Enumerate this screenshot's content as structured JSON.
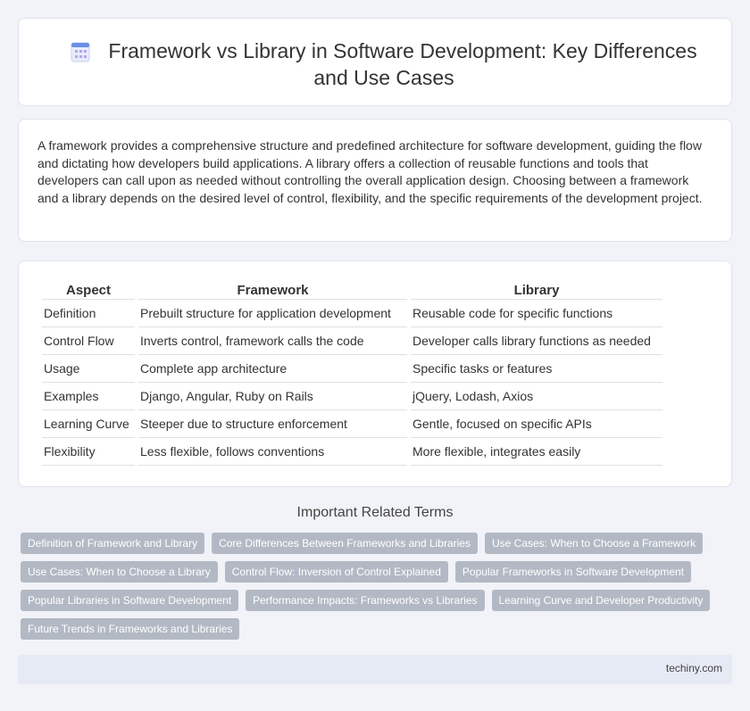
{
  "header": {
    "title": "Framework vs Library in Software Development: Key Differences and Use Cases",
    "icon": "document-icon"
  },
  "summary": {
    "text": "A framework provides a comprehensive structure and predefined architecture for software development, guiding the flow and dictating how developers build applications. A library offers a collection of reusable functions and tools that developers can call upon as needed without controlling the overall application design. Choosing between a framework and a library depends on the desired level of control, flexibility, and the specific requirements of the development project."
  },
  "table": {
    "headers": [
      "Aspect",
      "Framework",
      "Library"
    ],
    "rows": [
      [
        "Definition",
        "Prebuilt structure for application development",
        "Reusable code for specific functions"
      ],
      [
        "Control Flow",
        "Inverts control, framework calls the code",
        "Developer calls library functions as needed"
      ],
      [
        "Usage",
        "Complete app architecture",
        "Specific tasks or features"
      ],
      [
        "Examples",
        "Django, Angular, Ruby on Rails",
        "jQuery, Lodash, Axios"
      ],
      [
        "Learning Curve",
        "Steeper due to structure enforcement",
        "Gentle, focused on specific APIs"
      ],
      [
        "Flexibility",
        "Less flexible, follows conventions",
        "More flexible, integrates easily"
      ]
    ]
  },
  "related": {
    "heading": "Important Related Terms",
    "tags": [
      "Definition of Framework and Library",
      "Core Differences Between Frameworks and Libraries",
      "Use Cases: When to Choose a Framework",
      "Use Cases: When to Choose a Library",
      "Control Flow: Inversion of Control Explained",
      "Popular Frameworks in Software Development",
      "Popular Libraries in Software Development",
      "Performance Impacts: Frameworks vs Libraries",
      "Learning Curve and Developer Productivity",
      "Future Trends in Frameworks and Libraries"
    ]
  },
  "footer": {
    "site": "techiny.com"
  },
  "colors": {
    "background": "#f1f3f8",
    "card": "#ffffff",
    "tag": "#b3b9c4",
    "footer": "#e6eaf5"
  }
}
